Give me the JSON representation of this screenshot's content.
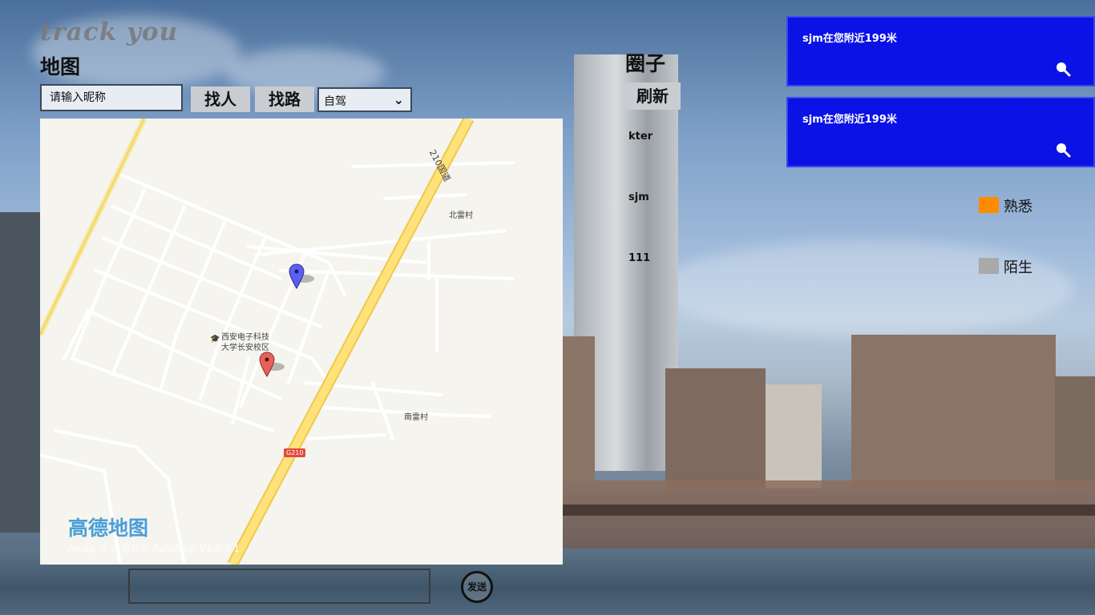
{
  "app": {
    "title": "track you"
  },
  "map_section": {
    "label": "地图",
    "nickname_input": {
      "placeholder": "请输入昵称",
      "value": "请输入昵称"
    },
    "find_person_button": "找人",
    "find_route_button": "找路",
    "travel_mode": {
      "selected": "自驾"
    },
    "map": {
      "place_labels": [
        "北雷村",
        "西安电子科技",
        "大学长安校区",
        "南雷村",
        "G210"
      ],
      "road_label": "210国道",
      "logo": "高德地图",
      "copyright": "Amap © 高德软件 AutoNavi V1.0.0.1",
      "markers": [
        {
          "name": "blue-marker",
          "color": "#5b5ff2"
        },
        {
          "name": "red-marker",
          "color": "#e8605a"
        }
      ]
    }
  },
  "circle_section": {
    "title": "圈子",
    "refresh_button": "刷新",
    "members": [
      "kter",
      "sjm",
      "111"
    ]
  },
  "notifications": [
    {
      "text": "sjm在您附近199米",
      "icon": "search-icon"
    },
    {
      "text": "sjm在您附近199米",
      "icon": "search-icon"
    }
  ],
  "legend": [
    {
      "label": "熟悉",
      "color": "#ff8c00"
    },
    {
      "label": "陌生",
      "color": "#a9a9a9"
    }
  ],
  "message_bar": {
    "send_button": "发送"
  }
}
